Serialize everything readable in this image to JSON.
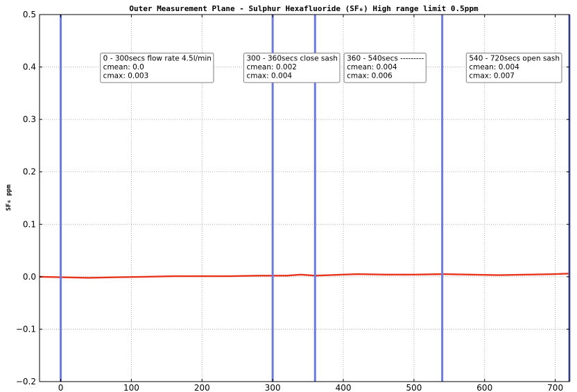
{
  "chart_data": {
    "type": "line",
    "title": "Outer Measurement Plane - Sulphur Hexafluoride (SF₆) High range limit 0.5ppm",
    "xlabel": "",
    "ylabel": "SF₆ ppm",
    "xlim": [
      -30,
      720
    ],
    "ylim": [
      -0.2,
      0.5
    ],
    "x_ticks": [
      0,
      100,
      200,
      300,
      400,
      500,
      600,
      700
    ],
    "y_ticks": [
      -0.2,
      -0.1,
      0.0,
      0.1,
      0.2,
      0.3,
      0.4,
      0.5
    ],
    "x_tick_labels": [
      "0",
      "100",
      "200",
      "300",
      "400",
      "500",
      "600",
      "700"
    ],
    "y_tick_labels": [
      "−0.2",
      "−0.1",
      "0.0",
      "0.1",
      "0.2",
      "0.3",
      "0.4",
      "0.5"
    ],
    "grid": true,
    "series": [
      {
        "color": "#e8341c",
        "x": [
          -30,
          0,
          40,
          80,
          120,
          160,
          200,
          240,
          280,
          300,
          320,
          340,
          360,
          380,
          400,
          420,
          460,
          500,
          540,
          580,
          620,
          660,
          700,
          720
        ],
        "values": [
          0.0,
          -0.001,
          -0.002,
          -0.001,
          0.0,
          0.001,
          0.001,
          0.001,
          0.002,
          0.002,
          0.002,
          0.004,
          0.002,
          0.003,
          0.004,
          0.005,
          0.004,
          0.004,
          0.005,
          0.004,
          0.003,
          0.004,
          0.005,
          0.006
        ]
      }
    ],
    "vlines": [
      {
        "x": 0,
        "color": "#6b7be0"
      },
      {
        "x": 300,
        "color": "#6b7be0"
      },
      {
        "x": 360,
        "color": "#6b7be0"
      },
      {
        "x": 540,
        "color": "#6b7be0"
      },
      {
        "x": 720,
        "color": "#6b7be0"
      }
    ],
    "annotations": [
      {
        "x": 60,
        "y": 0.42,
        "lines": [
          "0 - 300secs flow rate 4.5l/min",
          "cmean: 0.0",
          "cmax: 0.003"
        ]
      },
      {
        "x": 263,
        "y": 0.42,
        "lines": [
          "300 - 360secs close sash",
          "cmean: 0.002",
          "cmax: 0.004"
        ]
      },
      {
        "x": 405,
        "y": 0.42,
        "lines": [
          "360 - 540secs ---------",
          "cmean: 0.004",
          "cmax: 0.006"
        ]
      },
      {
        "x": 578,
        "y": 0.42,
        "lines": [
          "540 - 720secs open sash",
          "cmean: 0.004",
          "cmax: 0.007"
        ]
      }
    ]
  }
}
